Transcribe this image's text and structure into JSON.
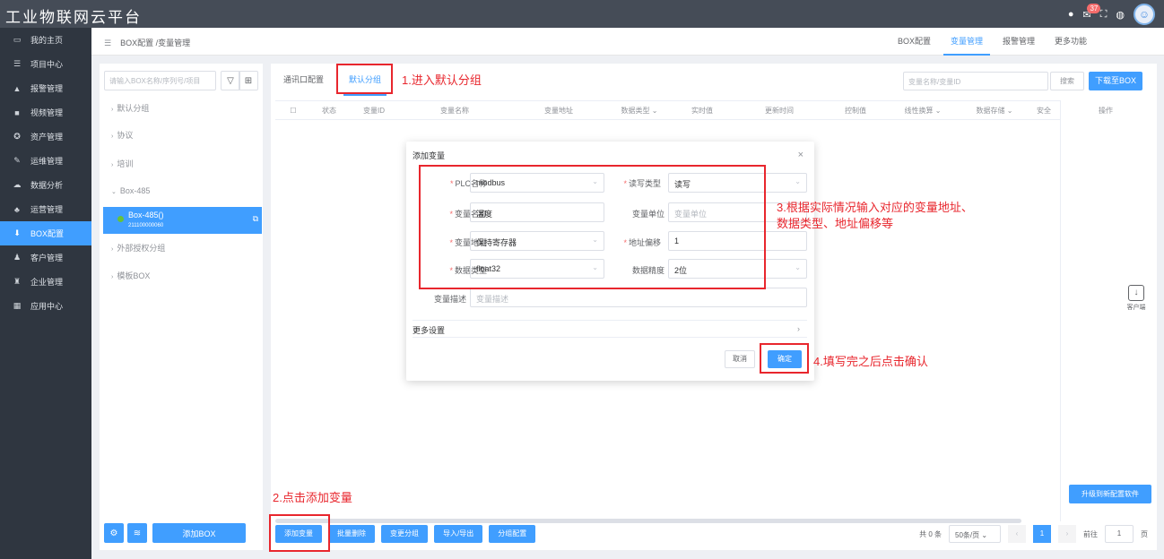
{
  "app": {
    "title": "工业物联网云平台",
    "badge_count": "37"
  },
  "sidebar": {
    "items": [
      {
        "label": "我的主页",
        "icon": "laptop-icon"
      },
      {
        "label": "项目中心",
        "icon": "list-icon"
      },
      {
        "label": "报警管理",
        "icon": "bell-icon"
      },
      {
        "label": "视频管理",
        "icon": "video-icon"
      },
      {
        "label": "资产管理",
        "icon": "asset-icon"
      },
      {
        "label": "运维管理",
        "icon": "wrench-icon"
      },
      {
        "label": "数据分析",
        "icon": "cloud-icon"
      },
      {
        "label": "运营管理",
        "icon": "people-icon"
      },
      {
        "label": "BOX配置",
        "icon": "download-icon",
        "active": true
      },
      {
        "label": "客户管理",
        "icon": "users-icon"
      },
      {
        "label": "企业管理",
        "icon": "org-icon"
      },
      {
        "label": "应用中心",
        "icon": "grid-icon"
      }
    ]
  },
  "header": {
    "breadcrumb": "BOX配置 /变量管理",
    "tabs": [
      "BOX配置",
      "变量管理",
      "报警管理",
      "更多功能"
    ],
    "active_tab": "变量管理"
  },
  "left_panel": {
    "search_placeholder": "请输入BOX名称/序列号/项目",
    "tree": [
      "默认分组",
      "协议",
      "培训",
      "Box-485",
      "外部授权分组",
      "模板BOX"
    ],
    "selected_box": {
      "name": "Box-485()",
      "serial": "211100000060"
    },
    "add_box": "添加BOX"
  },
  "main": {
    "group_tabs": [
      "通讯口配置",
      "默认分组"
    ],
    "active_group_tab": "默认分组",
    "search_placeholder": "变量名称/变量ID",
    "search_button": "搜索",
    "download_button": "下载至BOX",
    "columns": [
      "状态",
      "变量ID",
      "变量名称",
      "变量地址",
      "数据类型",
      "实时值",
      "更新时间",
      "控制值",
      "线性换算",
      "数据存储",
      "安全"
    ],
    "ops_column": "操作",
    "upgrade_button": "升级到新配置软件",
    "actions": [
      "添加变量",
      "批量删除",
      "变更分组",
      "导入/导出",
      "分组配置"
    ],
    "pager": {
      "total": "共 0 条",
      "page_size": "50条/页",
      "current": "1",
      "goto_label": "前往",
      "goto_value": "1",
      "page_unit": "页"
    },
    "client_label": "客户端"
  },
  "modal": {
    "title": "添加变量",
    "fields": {
      "plc_label": "PLC名称",
      "plc_value": "modbus",
      "rw_label": "读写类型",
      "rw_value": "读写",
      "name_label": "变量名称",
      "name_value": "温度",
      "unit_label": "变量单位",
      "unit_placeholder": "变量单位",
      "addr_label": "变量地址",
      "addr_value": "保持寄存器",
      "offset_label": "地址偏移",
      "offset_value": "1",
      "dtype_label": "数据类型",
      "dtype_value": "float32",
      "prec_label": "数据精度",
      "prec_value": "2位",
      "desc_label": "变量描述",
      "desc_placeholder": "变量描述"
    },
    "more_settings": "更多设置",
    "cancel": "取消",
    "confirm": "确定"
  },
  "annotations": {
    "step1": "1.进入默认分组",
    "step2": "2.点击添加变量",
    "step3_line1": "3.根据实际情况输入对应的变量地址、",
    "step3_line2": "数据类型、地址偏移等",
    "step4": "4.填写完之后点击确认"
  }
}
